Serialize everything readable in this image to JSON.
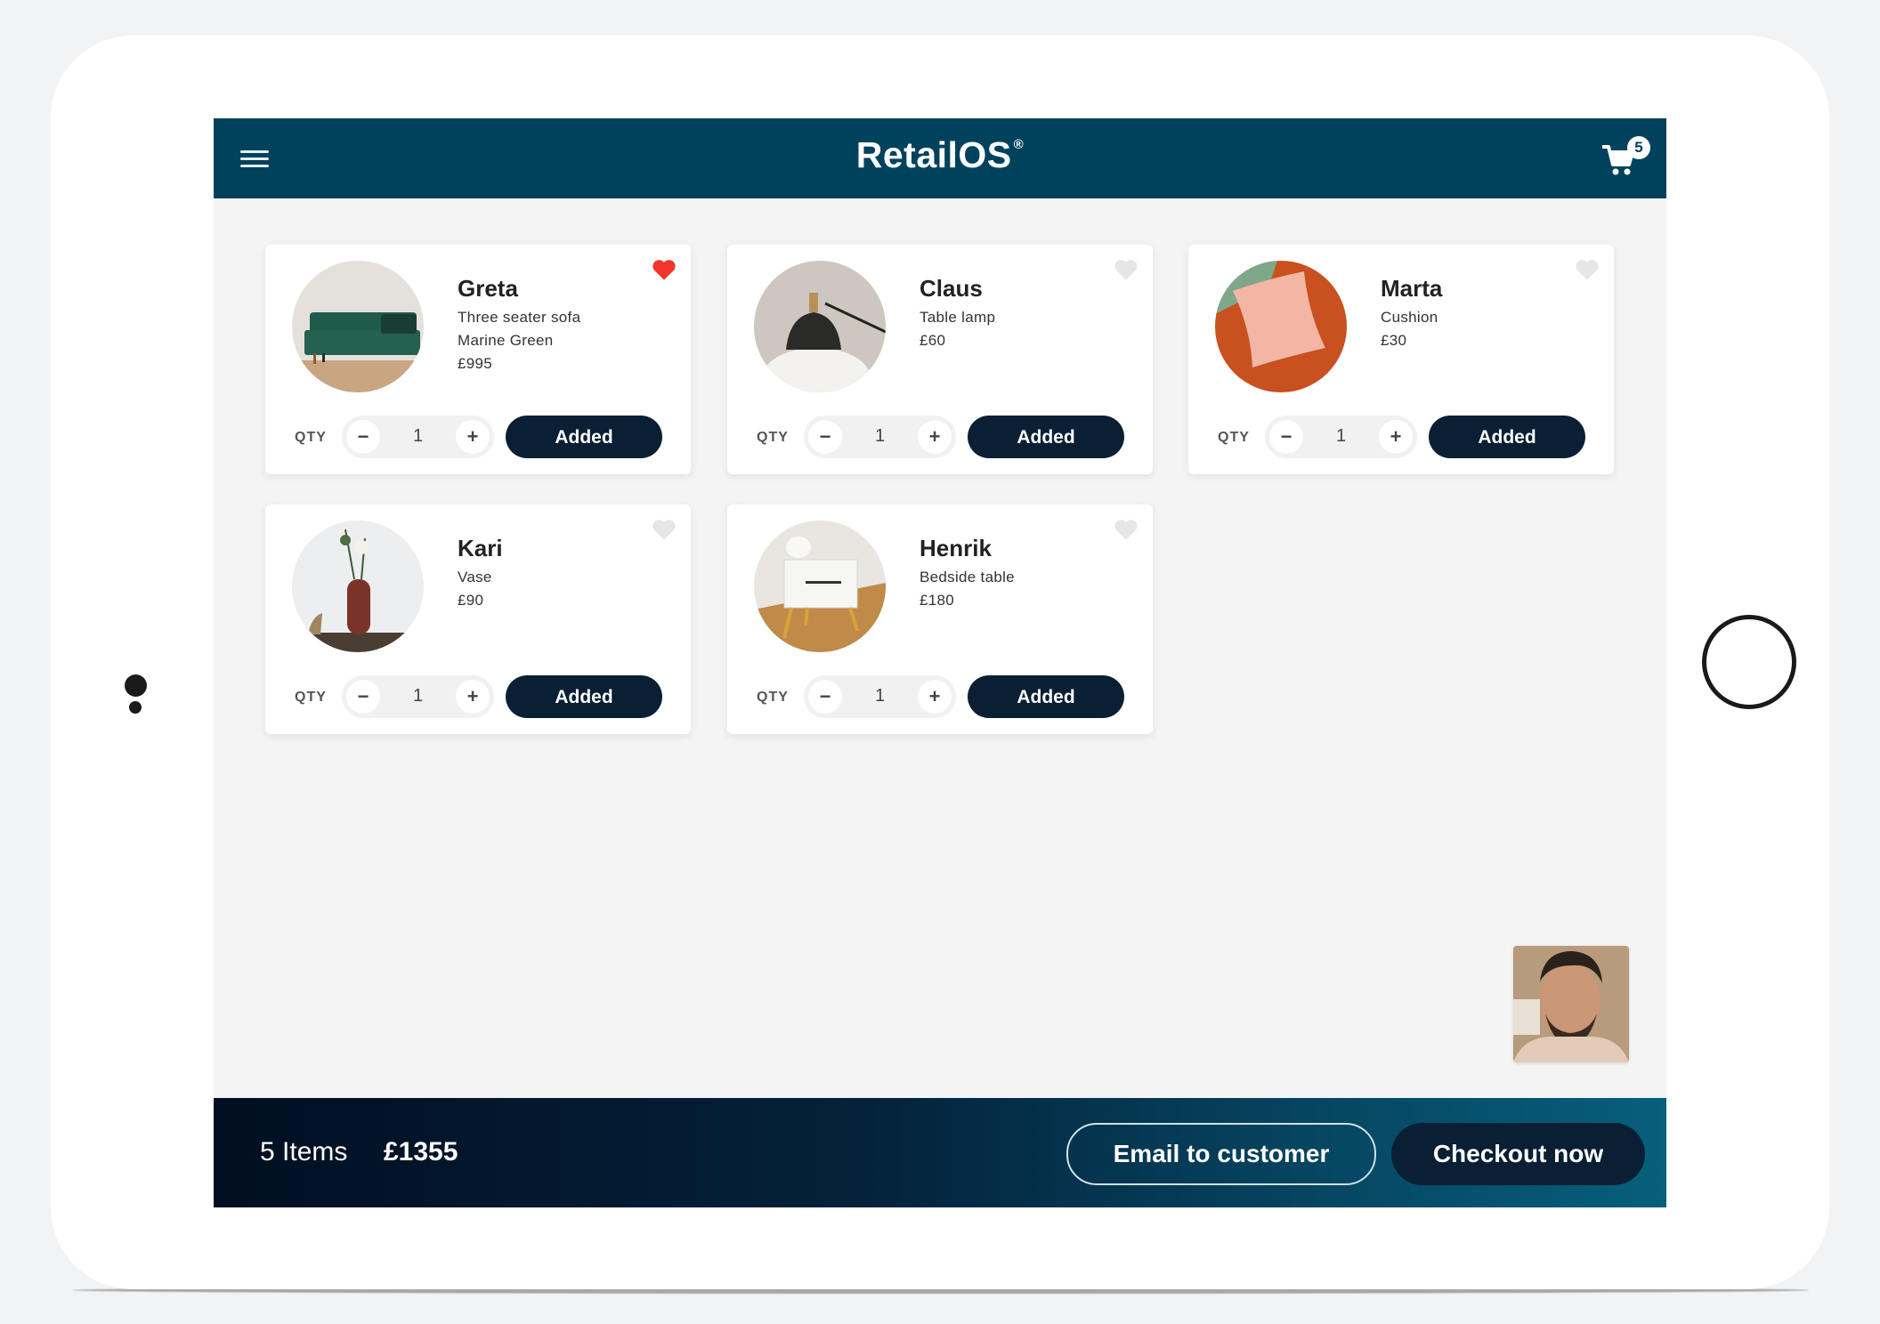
{
  "header": {
    "logo": "RetailOS",
    "logo_mark": "®",
    "menu_icon": "hamburger-menu-icon",
    "cart_icon": "shopping-cart-icon",
    "cart_count": "5",
    "brand_color": "#00425c"
  },
  "products": [
    {
      "name": "Greta",
      "lines": [
        "Three seater sofa",
        "Marine Green",
        "£995"
      ],
      "favorite": true,
      "qty_label": "QTY",
      "qty": "1",
      "minus": "−",
      "plus": "+",
      "button": "Added"
    },
    {
      "name": "Claus",
      "lines": [
        "Table lamp",
        "£60"
      ],
      "favorite": false,
      "qty_label": "QTY",
      "qty": "1",
      "minus": "−",
      "plus": "+",
      "button": "Added"
    },
    {
      "name": "Marta",
      "lines": [
        "Cushion",
        "£30"
      ],
      "favorite": false,
      "qty_label": "QTY",
      "qty": "1",
      "minus": "−",
      "plus": "+",
      "button": "Added"
    },
    {
      "name": "Kari",
      "lines": [
        "Vase",
        "£90"
      ],
      "favorite": false,
      "qty_label": "QTY",
      "qty": "1",
      "minus": "−",
      "plus": "+",
      "button": "Added"
    },
    {
      "name": "Henrik",
      "lines": [
        "Bedside table",
        "£180"
      ],
      "favorite": false,
      "qty_label": "QTY",
      "qty": "1",
      "minus": "−",
      "plus": "+",
      "button": "Added"
    }
  ],
  "colors": {
    "heart_active": "#f0352a",
    "heart_inactive": "#e6e6e6",
    "button_dark": "#0a1f33"
  },
  "footer": {
    "items": "5 Items",
    "total": "£1355",
    "email_button": "Email to customer",
    "checkout_button": "Checkout now"
  }
}
